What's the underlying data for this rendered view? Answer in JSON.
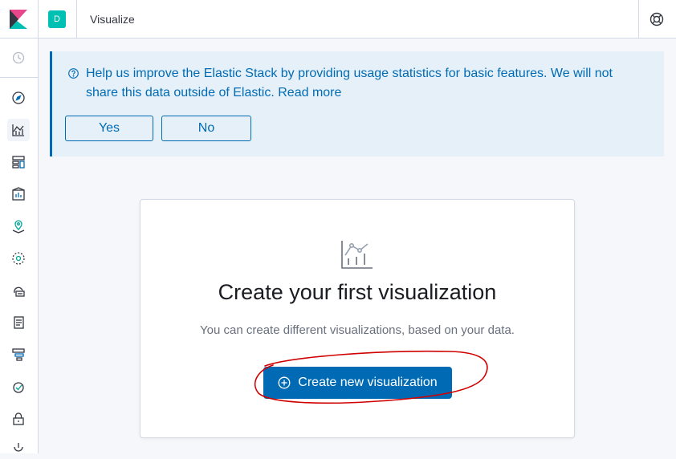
{
  "header": {
    "logo_icon": "kibana-logo-icon",
    "space_initial": "D",
    "page_title": "Visualize",
    "help_icon": "help-lifebuoy-icon"
  },
  "sidebar": {
    "items": [
      {
        "icon": "recently-viewed-clock-icon"
      },
      {
        "icon": "discover-compass-icon"
      },
      {
        "icon": "visualize-chart-icon",
        "active": true
      },
      {
        "icon": "dashboard-icon"
      },
      {
        "icon": "canvas-icon"
      },
      {
        "icon": "maps-icon"
      },
      {
        "icon": "machine-learning-icon"
      },
      {
        "icon": "infrastructure-icon"
      },
      {
        "icon": "logs-icon"
      },
      {
        "icon": "apm-icon"
      },
      {
        "icon": "uptime-icon"
      },
      {
        "icon": "siem-lock-icon"
      },
      {
        "icon": "dev-tools-icon"
      }
    ]
  },
  "callout": {
    "icon": "help-circle-icon",
    "text": "Help us improve the Elastic Stack by providing usage statistics for basic features. We will not share this data outside of Elastic. Read more",
    "yes_label": "Yes",
    "no_label": "No"
  },
  "empty_prompt": {
    "icon": "visualize-app-icon",
    "title": "Create your first visualization",
    "body": "You can create different visualizations, based on your data.",
    "button_label": "Create new visualization",
    "button_icon": "plus-in-circle-icon"
  },
  "colors": {
    "primary": "#006bb4",
    "callout_bg": "#e6f0f8",
    "space_avatar": "#00bfb3",
    "annotation": "#d00000"
  }
}
